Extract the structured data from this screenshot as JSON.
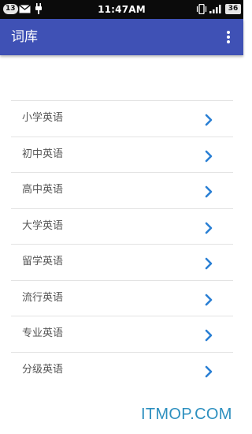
{
  "status_bar": {
    "notification_count": "13",
    "time": "11:47AM",
    "battery": "36",
    "icons": [
      "mail-icon",
      "usb-plug-icon",
      "vibrate-icon",
      "signal-icon",
      "battery-icon"
    ]
  },
  "app_bar": {
    "title": "词库",
    "menu_icon": "more-vert-icon",
    "color": "#3f51b5"
  },
  "list": {
    "chevron_color": "#2a7fd4",
    "items": [
      {
        "label": "小学英语"
      },
      {
        "label": "初中英语"
      },
      {
        "label": "高中英语"
      },
      {
        "label": "大学英语"
      },
      {
        "label": "留学英语"
      },
      {
        "label": "流行英语"
      },
      {
        "label": "专业英语"
      },
      {
        "label": "分级英语"
      }
    ]
  },
  "watermark": "ITMOP.COM"
}
